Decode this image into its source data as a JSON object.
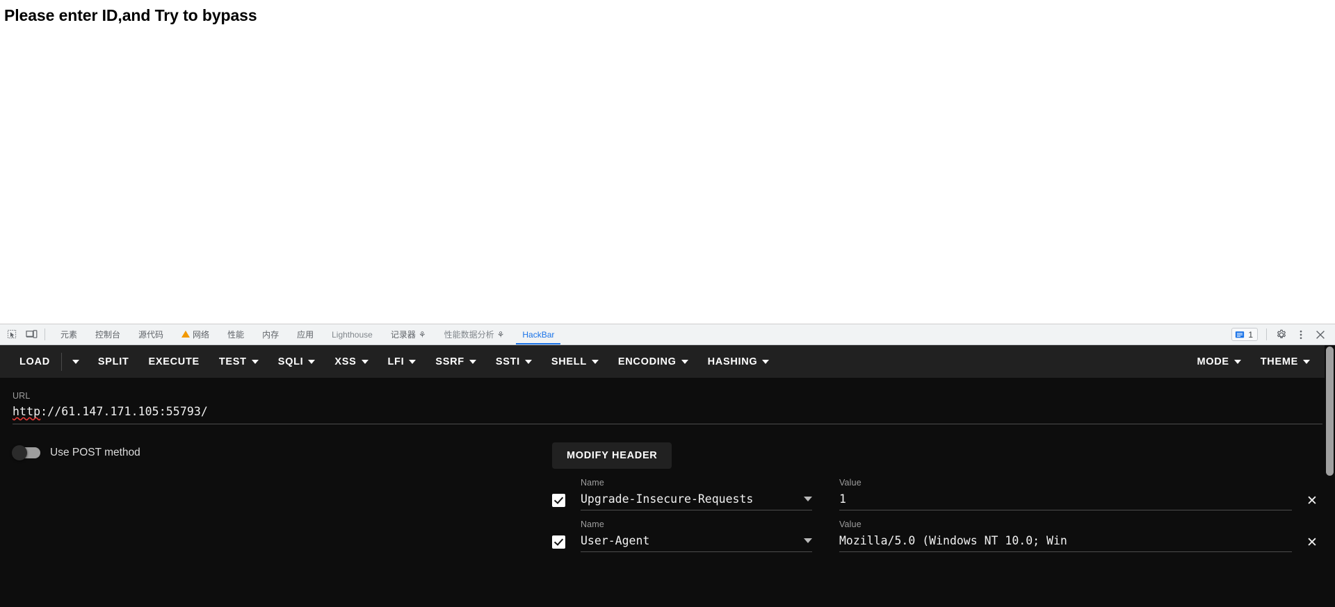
{
  "page": {
    "heading": "Please enter ID,and Try to bypass"
  },
  "devtools": {
    "icons": {
      "inspect": "inspect-element-icon",
      "device": "device-toolbar-icon"
    },
    "tabs": [
      {
        "label": "元素",
        "icon": "",
        "active": false
      },
      {
        "label": "控制台",
        "icon": "",
        "active": false
      },
      {
        "label": "源代码",
        "icon": "",
        "active": false
      },
      {
        "label": "网络",
        "icon": "warning-triangle-icon",
        "active": false
      },
      {
        "label": "性能",
        "icon": "",
        "active": false
      },
      {
        "label": "内存",
        "icon": "",
        "active": false
      },
      {
        "label": "应用",
        "icon": "",
        "active": false
      },
      {
        "label": "Lighthouse",
        "icon": "",
        "active": false
      },
      {
        "label": "记录器",
        "icon": "flask-icon",
        "active": false
      },
      {
        "label": "性能数据分析",
        "icon": "flask-icon",
        "active": false
      },
      {
        "label": "HackBar",
        "icon": "",
        "active": true
      }
    ],
    "message_count": "1",
    "right_icons": {
      "messages": "message-icon",
      "settings": "gear-icon",
      "more": "kebab-menu-icon",
      "close": "close-icon"
    },
    "accent_color": "#1a73e8",
    "warning_color": "#f29900"
  },
  "hackbar": {
    "toolbar": [
      {
        "label": "LOAD",
        "caret": false
      },
      {
        "label": "SPLIT",
        "caret": false
      },
      {
        "label": "EXECUTE",
        "caret": false
      },
      {
        "label": "TEST",
        "caret": true
      },
      {
        "label": "SQLI",
        "caret": true
      },
      {
        "label": "XSS",
        "caret": true
      },
      {
        "label": "LFI",
        "caret": true
      },
      {
        "label": "SSRF",
        "caret": true
      },
      {
        "label": "SSTI",
        "caret": true
      },
      {
        "label": "SHELL",
        "caret": true
      },
      {
        "label": "ENCODING",
        "caret": true
      },
      {
        "label": "HASHING",
        "caret": true
      }
    ],
    "toolbar_right": [
      {
        "label": "MODE",
        "caret": true
      },
      {
        "label": "THEME",
        "caret": true
      }
    ],
    "url": {
      "label": "URL",
      "value": "http://61.147.171.105:55793/",
      "spellcheck_word": "http",
      "rest": "://61.147.171.105:55793/"
    },
    "post_toggle": {
      "label": "Use POST method",
      "enabled": false
    },
    "modify_header_button": "MODIFY HEADER",
    "header_columns": {
      "name": "Name",
      "value": "Value"
    },
    "headers": [
      {
        "checked": true,
        "name": "Upgrade-Insecure-Requests",
        "value": "1"
      },
      {
        "checked": true,
        "name": "User-Agent",
        "value": "Mozilla/5.0 (Windows NT 10.0; Win"
      }
    ],
    "background": "#0d0d0d",
    "toolbar_background": "#212121"
  }
}
